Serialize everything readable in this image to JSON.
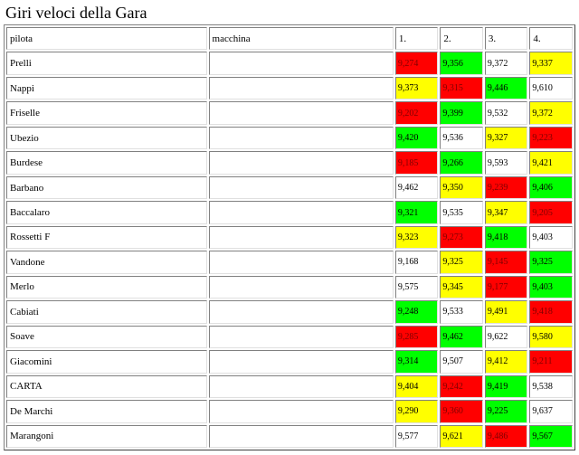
{
  "page": {
    "title": "Giri veloci della Gara"
  },
  "table": {
    "headers": {
      "pilot": "pilota",
      "car": "macchina",
      "laps": [
        "1.",
        "2.",
        "3.",
        "4."
      ]
    },
    "rows": [
      {
        "pilot": "Prelli",
        "times": [
          "9,274",
          "9,356",
          "9,372",
          "9,337"
        ],
        "colors": [
          "red",
          "green",
          "white",
          "yellow"
        ]
      },
      {
        "pilot": "Nappi",
        "times": [
          "9,373",
          "9,315",
          "9,446",
          "9,610"
        ],
        "colors": [
          "yellow",
          "red",
          "green",
          "white"
        ]
      },
      {
        "pilot": "Friselle",
        "times": [
          "9,202",
          "9,399",
          "9,532",
          "9,372"
        ],
        "colors": [
          "red",
          "green",
          "white",
          "yellow"
        ]
      },
      {
        "pilot": "Ubezio",
        "times": [
          "9,420",
          "9,536",
          "9,327",
          "9,223"
        ],
        "colors": [
          "green",
          "white",
          "yellow",
          "red"
        ]
      },
      {
        "pilot": "Burdese",
        "times": [
          "9,185",
          "9,266",
          "9,593",
          "9,421"
        ],
        "colors": [
          "red",
          "green",
          "white",
          "yellow"
        ]
      },
      {
        "pilot": "Barbano",
        "times": [
          "9,462",
          "9,350",
          "9,239",
          "9,406"
        ],
        "colors": [
          "white",
          "yellow",
          "red",
          "green"
        ]
      },
      {
        "pilot": "Baccalaro",
        "times": [
          "9,321",
          "9,535",
          "9,347",
          "9,205"
        ],
        "colors": [
          "green",
          "white",
          "yellow",
          "red"
        ]
      },
      {
        "pilot": "Rossetti F",
        "times": [
          "9,323",
          "9,273",
          "9,418",
          "9,403"
        ],
        "colors": [
          "yellow",
          "red",
          "green",
          "white"
        ]
      },
      {
        "pilot": "Vandone",
        "times": [
          "9,168",
          "9,325",
          "9,145",
          "9,325"
        ],
        "colors": [
          "white",
          "yellow",
          "red",
          "green"
        ]
      },
      {
        "pilot": "Merlo",
        "times": [
          "9,575",
          "9,345",
          "9,177",
          "9,403"
        ],
        "colors": [
          "white",
          "yellow",
          "red",
          "green"
        ]
      },
      {
        "pilot": "Cabiati",
        "times": [
          "9,248",
          "9,533",
          "9,491",
          "9,418"
        ],
        "colors": [
          "green",
          "white",
          "yellow",
          "red"
        ]
      },
      {
        "pilot": "Soave",
        "times": [
          "9,285",
          "9,462",
          "9,622",
          "9,580"
        ],
        "colors": [
          "red",
          "green",
          "white",
          "yellow"
        ]
      },
      {
        "pilot": "Giacomini",
        "times": [
          "9,314",
          "9,507",
          "9,412",
          "9,211"
        ],
        "colors": [
          "green",
          "white",
          "yellow",
          "red"
        ]
      },
      {
        "pilot": "CARTA",
        "times": [
          "9,404",
          "9,242",
          "9,419",
          "9,538"
        ],
        "colors": [
          "yellow",
          "red",
          "green",
          "white"
        ]
      },
      {
        "pilot": "De Marchi",
        "times": [
          "9,290",
          "9,360",
          "9,225",
          "9,637"
        ],
        "colors": [
          "yellow",
          "red",
          "green",
          "white"
        ]
      },
      {
        "pilot": "Marangoni",
        "times": [
          "9,577",
          "9,621",
          "9,486",
          "9,567"
        ],
        "colors": [
          "white",
          "yellow",
          "red",
          "green"
        ]
      }
    ]
  },
  "colors": {
    "red": "#ff0000",
    "green": "#00ff00",
    "yellow": "#ffff00",
    "white": "#ffffff"
  }
}
